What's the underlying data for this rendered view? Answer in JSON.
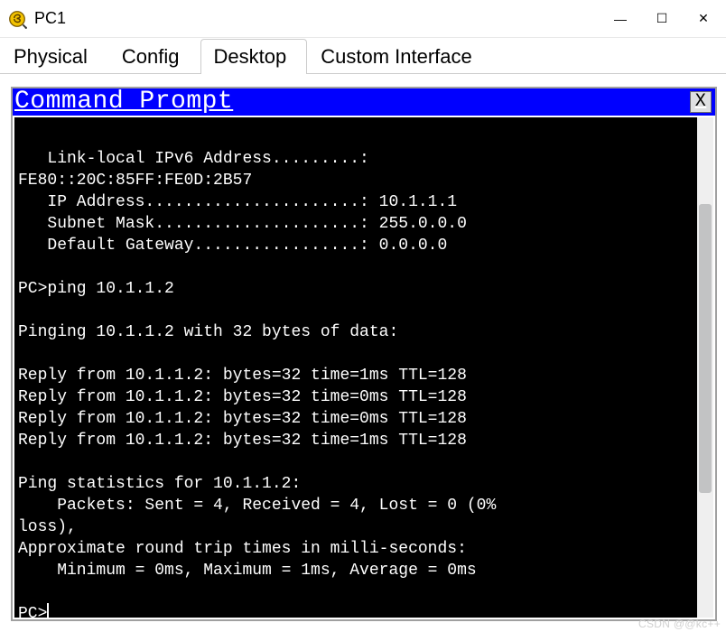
{
  "window": {
    "title": "PC1",
    "buttons": {
      "min": "—",
      "max": "☐",
      "close": "✕"
    }
  },
  "tabs": {
    "items": [
      {
        "label": "Physical"
      },
      {
        "label": "Config"
      },
      {
        "label": "Desktop"
      },
      {
        "label": "Custom Interface"
      }
    ],
    "active_index": 2
  },
  "command_prompt": {
    "title": "Command Prompt",
    "close_label": "X",
    "lines": [
      "",
      "   Link-local IPv6 Address.........:",
      "FE80::20C:85FF:FE0D:2B57",
      "   IP Address......................: 10.1.1.1",
      "   Subnet Mask.....................: 255.0.0.0",
      "   Default Gateway.................: 0.0.0.0",
      "",
      "PC>ping 10.1.1.2",
      "",
      "Pinging 10.1.1.2 with 32 bytes of data:",
      "",
      "Reply from 10.1.1.2: bytes=32 time=1ms TTL=128",
      "Reply from 10.1.1.2: bytes=32 time=0ms TTL=128",
      "Reply from 10.1.1.2: bytes=32 time=0ms TTL=128",
      "Reply from 10.1.1.2: bytes=32 time=1ms TTL=128",
      "",
      "Ping statistics for 10.1.1.2:",
      "    Packets: Sent = 4, Received = 4, Lost = 0 (0%",
      "loss),",
      "Approximate round trip times in milli-seconds:",
      "    Minimum = 0ms, Maximum = 1ms, Average = 0ms",
      "",
      "PC>"
    ]
  },
  "watermark": "CSDN @@kc++"
}
